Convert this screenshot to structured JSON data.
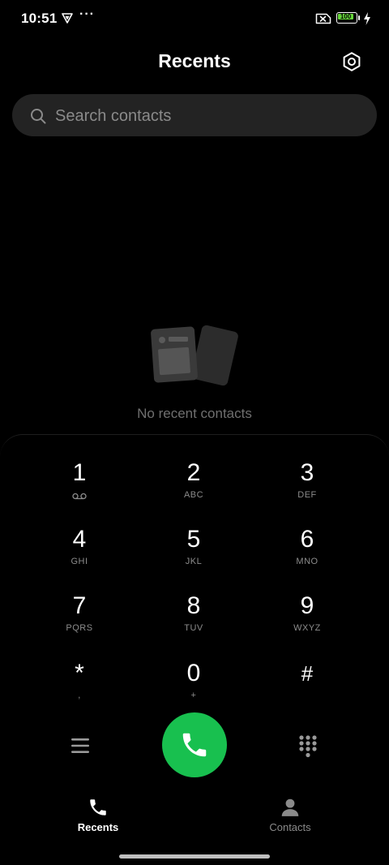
{
  "status_bar": {
    "time": "10:51",
    "more": "···",
    "battery_percent": "100",
    "battery_color": "#66d63a",
    "icons": [
      "vpn-icon",
      "sim-no-signal-icon",
      "battery-icon",
      "charging-bolt-icon"
    ]
  },
  "header": {
    "title": "Recents",
    "settings_icon": "gear-icon"
  },
  "search": {
    "placeholder": "Search contacts",
    "value": ""
  },
  "empty_state": {
    "message": "No recent contacts",
    "illustration": "contact-cards-illustration"
  },
  "dialpad": {
    "keys": [
      {
        "digit": "1",
        "letters": "",
        "icon": "voicemail-icon"
      },
      {
        "digit": "2",
        "letters": "ABC"
      },
      {
        "digit": "3",
        "letters": "DEF"
      },
      {
        "digit": "4",
        "letters": "GHI"
      },
      {
        "digit": "5",
        "letters": "JKL"
      },
      {
        "digit": "6",
        "letters": "MNO"
      },
      {
        "digit": "7",
        "letters": "PQRS"
      },
      {
        "digit": "8",
        "letters": "TUV"
      },
      {
        "digit": "9",
        "letters": "WXYZ"
      },
      {
        "digit": "*",
        "letters": ","
      },
      {
        "digit": "0",
        "letters": "+"
      },
      {
        "digit": "#",
        "letters": ""
      }
    ],
    "call_button_color": "#18c04f",
    "menu_icon": "menu-icon",
    "keypad_toggle_icon": "dialpad-icon"
  },
  "bottom_nav": {
    "items": [
      {
        "label": "Recents",
        "icon": "phone-icon",
        "active": true
      },
      {
        "label": "Contacts",
        "icon": "person-icon",
        "active": false
      }
    ]
  }
}
